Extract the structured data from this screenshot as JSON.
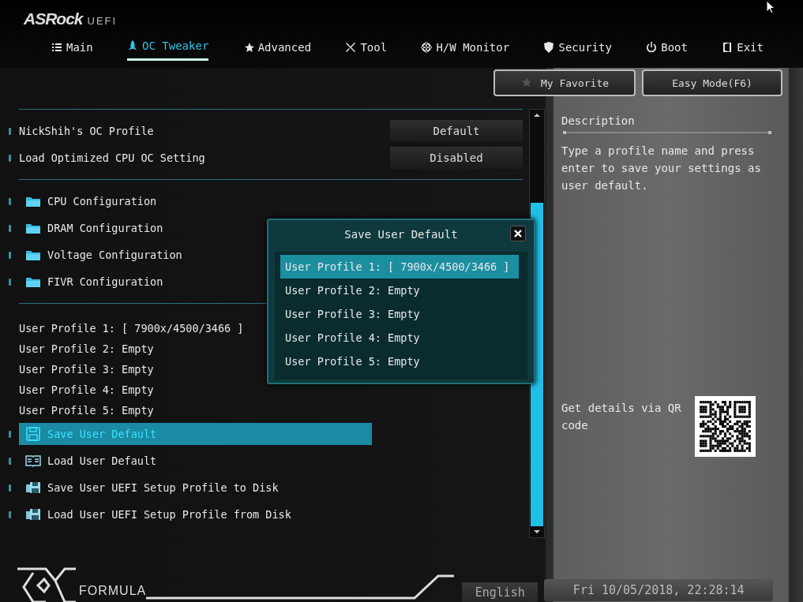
{
  "brand": {
    "logo": "ASRock",
    "suffix": "UEFI"
  },
  "tabs": [
    {
      "label": "Main",
      "kind": "list",
      "selected": false
    },
    {
      "label": "OC Tweaker",
      "kind": "rocket",
      "selected": true
    },
    {
      "label": "Advanced",
      "kind": "star",
      "selected": false
    },
    {
      "label": "Tool",
      "kind": "tools",
      "selected": false
    },
    {
      "label": "H/W Monitor",
      "kind": "target",
      "selected": false
    },
    {
      "label": "Security",
      "kind": "shield",
      "selected": false
    },
    {
      "label": "Boot",
      "kind": "power",
      "selected": false
    },
    {
      "label": "Exit",
      "kind": "door",
      "selected": false
    }
  ],
  "top_buttons": [
    {
      "label": "My Favorite",
      "kind": "star"
    },
    {
      "label": "Easy Mode(F6)",
      "kind": "plain"
    }
  ],
  "settings": [
    {
      "label": "NickShih's OC Profile",
      "value": "Default"
    },
    {
      "label": "Load Optimized CPU OC Setting",
      "value": "Disabled"
    }
  ],
  "folders": [
    {
      "label": "CPU Configuration"
    },
    {
      "label": "DRAM Configuration"
    },
    {
      "label": "Voltage Configuration"
    },
    {
      "label": "FIVR Configuration"
    }
  ],
  "profiles": [
    "User Profile 1: [ 7900x/4500/3466 ]",
    "User Profile 2: Empty",
    "User Profile 3: Empty",
    "User Profile 4: Empty",
    "User Profile 5: Empty"
  ],
  "actions": [
    {
      "label": "Save User Default",
      "kind": "save",
      "selected": true
    },
    {
      "label": "Load User Default",
      "kind": "book",
      "selected": false
    },
    {
      "label": "Save User UEFI Setup Profile to Disk",
      "kind": "disk",
      "selected": false
    },
    {
      "label": "Load User UEFI Setup Profile from Disk",
      "kind": "disk",
      "selected": false
    }
  ],
  "dialog": {
    "title": "Save User Default",
    "items": [
      {
        "label": "User Profile 1: [ 7900x/4500/3466 ]",
        "selected": true
      },
      {
        "label": "User Profile 2: Empty",
        "selected": false
      },
      {
        "label": "User Profile 3: Empty",
        "selected": false
      },
      {
        "label": "User Profile 4: Empty",
        "selected": false
      },
      {
        "label": "User Profile 5: Empty",
        "selected": false
      }
    ]
  },
  "description": {
    "heading": "Description",
    "text": "Type a profile name and press enter to save your settings as user default."
  },
  "qr": {
    "text": "Get details via QR code"
  },
  "footer": {
    "brand": "FORMULA",
    "language": "English",
    "datetime": "Fri 10/05/2018, 22:28:14"
  }
}
